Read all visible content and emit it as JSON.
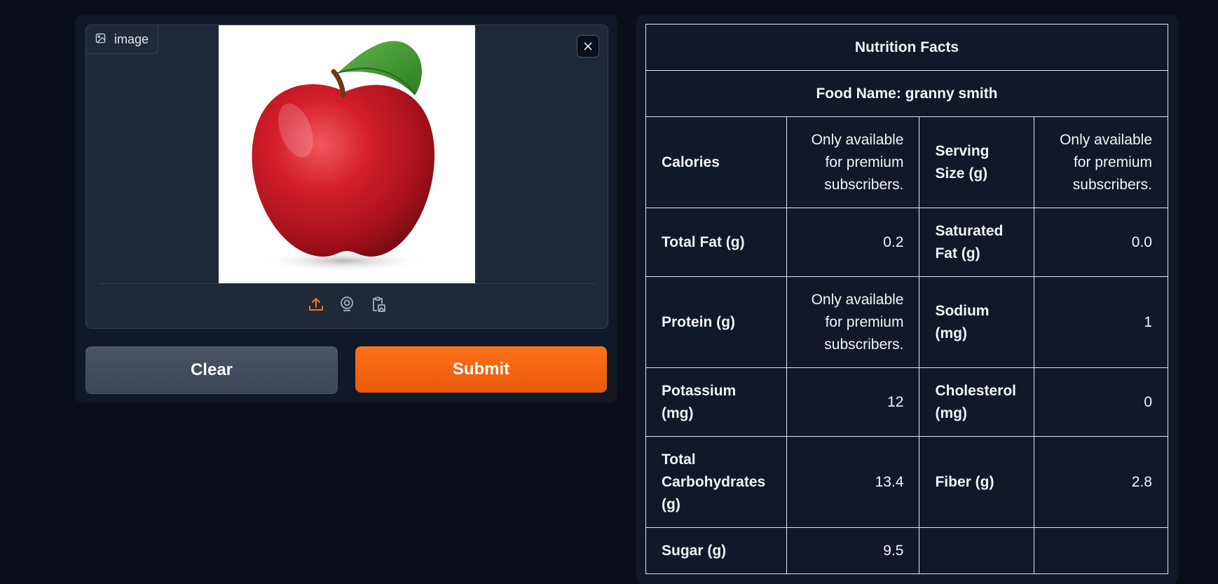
{
  "image_input": {
    "label": "image",
    "label_icon": "image-icon",
    "close_icon": "close-icon",
    "source_icons": [
      "upload-icon",
      "webcam-icon",
      "clipboard-icon"
    ],
    "upload_color": "#f97316"
  },
  "buttons": {
    "clear_label": "Clear",
    "submit_label": "Submit"
  },
  "nutrition": {
    "title": "Nutrition Facts",
    "food_name": "Food Name: granny smith",
    "rows": [
      {
        "l1": "Calories",
        "v1": "Only available for premium subscribers.",
        "l2": "Serving Size (g)",
        "v2": "Only available for premium subscribers."
      },
      {
        "l1": "Total Fat (g)",
        "v1": "0.2",
        "l2": "Saturated Fat (g)",
        "v2": "0.0"
      },
      {
        "l1": "Protein (g)",
        "v1": "Only available for premium subscribers.",
        "l2": "Sodium (mg)",
        "v2": "1"
      },
      {
        "l1": "Potassium (mg)",
        "v1": "12",
        "l2": "Cholesterol (mg)",
        "v2": "0"
      },
      {
        "l1": "Total Carbohydrates (g)",
        "v1": "13.4",
        "l2": "Fiber (g)",
        "v2": "2.8"
      },
      {
        "l1": "Sugar (g)",
        "v1": "9.5",
        "l2": "",
        "v2": ""
      }
    ]
  },
  "colors": {
    "background": "#0b0f19",
    "panel": "#111827",
    "accent": "#f97316"
  }
}
